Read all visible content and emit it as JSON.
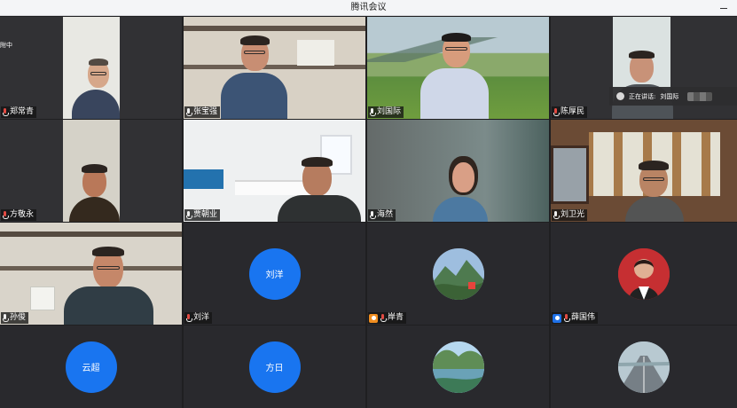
{
  "window": {
    "title": "腾讯会议"
  },
  "status": {
    "left_fragment": "附中",
    "speaking_prefix": "正在讲话:",
    "speaking_name": "刘国际"
  },
  "participants": [
    {
      "name": "郑常青"
    },
    {
      "name": "张宝强"
    },
    {
      "name": "刘国际"
    },
    {
      "name": "陈厚民"
    },
    {
      "name": "方敬永"
    },
    {
      "name": "贾朝业"
    },
    {
      "name": "海然"
    },
    {
      "name": "刘卫光"
    },
    {
      "name": "孙俊"
    },
    {
      "name": "刘洋",
      "avatar_text": "刘洋"
    },
    {
      "name": "岸青"
    },
    {
      "name": "薛国伟"
    },
    {
      "avatar_text": "云超"
    },
    {
      "avatar_text": "方日"
    }
  ],
  "colors": {
    "background": "#1f1f21",
    "tile": "#29292d",
    "active_speaker": "#6ad64f",
    "avatar_blue": "#1975f0"
  }
}
